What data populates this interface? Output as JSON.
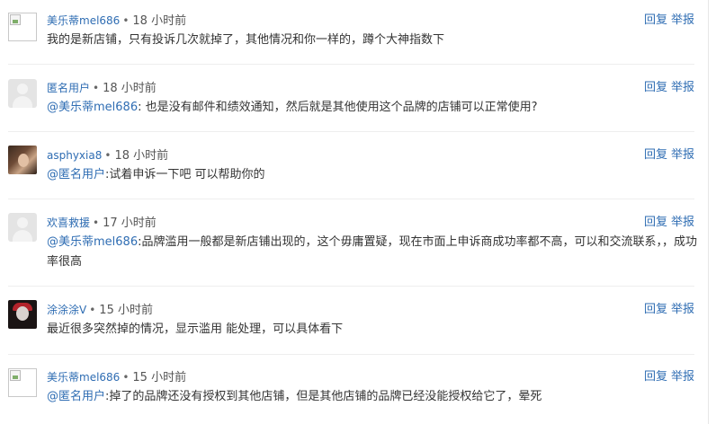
{
  "comments": [
    {
      "user": "美乐蒂mel686",
      "sep": "•",
      "time": "18 小时前",
      "mention": "",
      "text": "我的是新店铺，只有投诉几次就掉了，其他情况和你一样的，蹲个大神指数下",
      "reply": "回复",
      "report": "举报",
      "avatar": "broken-image-icon"
    },
    {
      "user": "匿名用户",
      "sep": "•",
      "time": "18 小时前",
      "mention": "@美乐蒂mel686",
      "text": ": 也是没有邮件和绩效通知，然后就是其他使用这个品牌的店铺可以正常使用?",
      "reply": "回复",
      "report": "举报",
      "avatar": "default-user-icon"
    },
    {
      "user": "asphyxia8",
      "sep": "•",
      "time": "18 小时前",
      "mention": "@匿名用户",
      "text": ":试着申诉一下吧 可以帮助你的",
      "reply": "回复",
      "report": "举报",
      "avatar": "user-photo"
    },
    {
      "user": "欢喜救援",
      "sep": "•",
      "time": "17 小时前",
      "mention": "@美乐蒂mel686",
      "text": ":品牌滥用一般都是新店铺出现的，这个毋庸置疑，现在市面上申诉商成功率都不高，可以和交流联系，，成功率很高",
      "reply": "回复",
      "report": "举报",
      "avatar": "default-user-icon"
    },
    {
      "user": "涂涂涂V",
      "sep": "•",
      "time": "15 小时前",
      "mention": "",
      "text": "最近很多突然掉的情况，显示滥用 能处理，可以具体看下",
      "reply": "回复",
      "report": "举报",
      "avatar": "user-photo"
    },
    {
      "user": "美乐蒂mel686",
      "sep": "•",
      "time": "15 小时前",
      "mention": "@匿名用户",
      "text": ":掉了的品牌还没有授权到其他店铺，但是其他店铺的品牌已经没能授权给它了，晕死",
      "reply": "回复",
      "report": "举报",
      "avatar": "broken-image-icon"
    }
  ]
}
